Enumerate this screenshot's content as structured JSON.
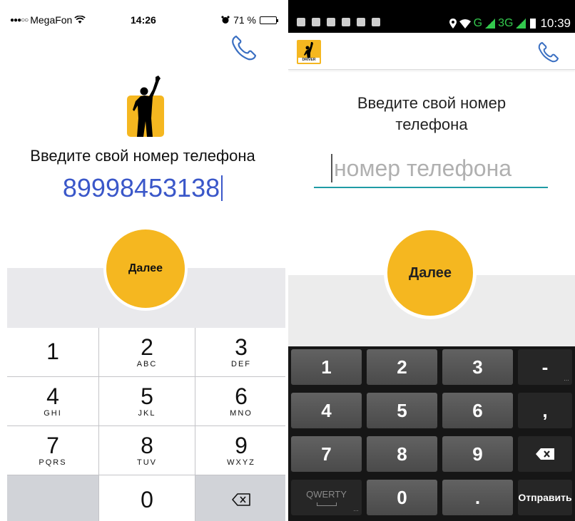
{
  "ios": {
    "status": {
      "signal_dots": "●●●○○",
      "carrier": "MegaFon",
      "time": "14:26",
      "battery_percent": "71 %",
      "battery_level": 0.71
    },
    "prompt": "Введите свой номер телефона",
    "phone_number": "89998453138",
    "next_button": "Далее",
    "keypad": [
      {
        "num": "1",
        "letters": ""
      },
      {
        "num": "2",
        "letters": "ABC"
      },
      {
        "num": "3",
        "letters": "DEF"
      },
      {
        "num": "4",
        "letters": "GHI"
      },
      {
        "num": "5",
        "letters": "JKL"
      },
      {
        "num": "6",
        "letters": "MNO"
      },
      {
        "num": "7",
        "letters": "PQRS"
      },
      {
        "num": "8",
        "letters": "TUV"
      },
      {
        "num": "9",
        "letters": "WXYZ"
      },
      {
        "num": "0",
        "letters": ""
      }
    ],
    "icons": {
      "call": "phone-icon",
      "delete": "backspace-icon",
      "logo": "raised-hand-figure-icon"
    }
  },
  "android": {
    "status": {
      "network_g": "G",
      "network_3g": "3G",
      "time": "10:39"
    },
    "logo_tag": "DRIVER",
    "prompt_line1": "Введите свой номер",
    "prompt_line2": "телефона",
    "input": {
      "placeholder": "номер телефона",
      "value": ""
    },
    "next_button": "Далее",
    "keypad": {
      "k1": "1",
      "k2": "2",
      "k3": "3",
      "k_dash": "-",
      "k4": "4",
      "k5": "5",
      "k6": "6",
      "k_comma": ",",
      "k7": "7",
      "k8": "8",
      "k9": "9",
      "k_qwerty": "QWERTY",
      "k0": "0",
      "k_dot": ".",
      "k_send": "Отправить"
    },
    "icons": {
      "call": "phone-icon",
      "delete": "backspace-icon"
    }
  },
  "colors": {
    "accent_yellow": "#f5b720",
    "ios_number_blue": "#3a57c9",
    "android_underline": "#1f9ca5"
  }
}
